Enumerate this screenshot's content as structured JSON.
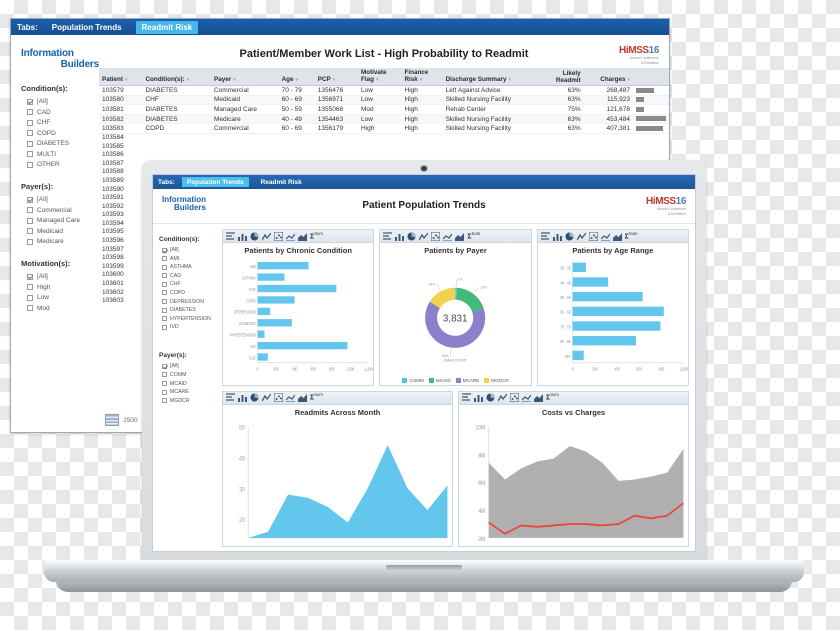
{
  "back_window": {
    "tabs_label": "Tabs:",
    "tabs": [
      {
        "label": "Population Trends",
        "active": false
      },
      {
        "label": "Readmit Risk",
        "active": true
      }
    ],
    "logo": {
      "line1": "Information",
      "line2": "Builders"
    },
    "title": "Patient/Member Work List - High Probability to Readmit",
    "himss": {
      "name": "HiMSS",
      "year": "16",
      "sub1": "Annual Conference",
      "sub2": "& Exhibition"
    },
    "filters": [
      {
        "label": "Condition(s):",
        "options": [
          {
            "text": "[All]",
            "checked": true
          },
          {
            "text": "CAD",
            "checked": false
          },
          {
            "text": "CHF",
            "checked": false
          },
          {
            "text": "COPD",
            "checked": false
          },
          {
            "text": "DIABETES",
            "checked": false
          },
          {
            "text": "MULTI",
            "checked": false
          },
          {
            "text": "OTHER",
            "checked": false
          }
        ]
      },
      {
        "label": "Payer(s):",
        "options": [
          {
            "text": "[All]",
            "checked": true
          },
          {
            "text": "Commercial",
            "checked": false
          },
          {
            "text": "Managed Care",
            "checked": false
          },
          {
            "text": "Medicaid",
            "checked": false
          },
          {
            "text": "Medicare",
            "checked": false
          }
        ]
      },
      {
        "label": "Motivation(s):",
        "options": [
          {
            "text": "[All]",
            "checked": true
          },
          {
            "text": "High",
            "checked": false
          },
          {
            "text": "Low",
            "checked": false
          },
          {
            "text": "Mod",
            "checked": false
          }
        ]
      }
    ],
    "table": {
      "columns": [
        "Patient",
        "Condition(s):",
        "Payer",
        "Age",
        "PCP",
        "Motivate\nFlag",
        "Finance\nRisk",
        "Discharge Summary",
        "Likely\nReadmit",
        "Charges",
        ""
      ],
      "rows": [
        {
          "patient": "103579",
          "condition": "DIABETES",
          "payer": "Commercial",
          "age": "70 - 79",
          "pcp": "1356476",
          "motivate": "Low",
          "finance": "High",
          "discharge": "Left Against Advice",
          "readmit": "63%",
          "charges": "268,487",
          "bar": 60
        },
        {
          "patient": "103580",
          "condition": "CHF",
          "payer": "Medicaid",
          "age": "60 - 69",
          "pcp": "1356971",
          "motivate": "Low",
          "finance": "High",
          "discharge": "Skilled Nursing Facility",
          "readmit": "63%",
          "charges": "115,923",
          "bar": 26
        },
        {
          "patient": "103581",
          "condition": "DIABETES",
          "payer": "Managed Care",
          "age": "50 - 59",
          "pcp": "1355068",
          "motivate": "Mod",
          "finance": "High",
          "discharge": "Rehab Center",
          "readmit": "75%",
          "charges": "121,678",
          "bar": 27
        },
        {
          "patient": "103582",
          "condition": "DIABETES",
          "payer": "Medicare",
          "age": "40 - 49",
          "pcp": "1354463",
          "motivate": "Low",
          "finance": "High",
          "discharge": "Skilled Nursing Facility",
          "readmit": "63%",
          "charges": "453,484",
          "bar": 100
        },
        {
          "patient": "103583",
          "condition": "COPD",
          "payer": "Commercial",
          "age": "60 - 69",
          "pcp": "1356179",
          "motivate": "High",
          "finance": "High",
          "discharge": "Skilled Nursing Facility",
          "readmit": "63%",
          "charges": "407,381",
          "bar": 90
        }
      ],
      "patient_ids_continued": [
        "103584",
        "103585",
        "103586",
        "103587",
        "103588",
        "103589",
        "103590",
        "103591",
        "103592",
        "103593",
        "103594",
        "103595",
        "103596",
        "103597",
        "103598",
        "103599",
        "103600",
        "103601",
        "103602",
        "103603"
      ],
      "footer_count": "2500"
    }
  },
  "laptop": {
    "tabs_label": "Tabs:",
    "tabs": [
      {
        "label": "Population Trends",
        "active": true
      },
      {
        "label": "Readmit Risk",
        "active": false
      }
    ],
    "logo": {
      "line1": "Information",
      "line2": "Builders"
    },
    "title": "Patient Population Trends",
    "himss": {
      "name": "HiMSS",
      "year": "16",
      "sub1": "Annual Conference",
      "sub2": "& Exhibition"
    },
    "toolbar": {
      "sum_label": "Σ",
      "sum_sup": "Sum"
    },
    "filters": [
      {
        "label": "Condition(s):",
        "options": [
          {
            "text": "[All]",
            "checked": true
          },
          {
            "text": "AMI",
            "checked": false
          },
          {
            "text": "ASTHMA",
            "checked": false
          },
          {
            "text": "CAD",
            "checked": false
          },
          {
            "text": "CHF",
            "checked": false
          },
          {
            "text": "COPD",
            "checked": false
          },
          {
            "text": "DEPRESSION",
            "checked": false
          },
          {
            "text": "DIABETES",
            "checked": false
          },
          {
            "text": "HYPERTENSION",
            "checked": false
          },
          {
            "text": "IVD",
            "checked": false
          }
        ]
      },
      {
        "label": "Payer(s):",
        "options": [
          {
            "text": "[All]",
            "checked": true
          },
          {
            "text": "COMM",
            "checked": false
          },
          {
            "text": "MCAID",
            "checked": false
          },
          {
            "text": "MCARE",
            "checked": false
          },
          {
            "text": "MGDCR",
            "checked": false
          }
        ]
      }
    ]
  },
  "chart_data": [
    {
      "type": "bar",
      "orientation": "horizontal",
      "title": "Patients by Chronic Condition",
      "categories": [
        "AMI",
        "ASTHMA",
        "CHF",
        "COPD",
        "DEPRESSION",
        "DIABETES",
        "HYPERTENSION",
        "IVD",
        "CAD"
      ],
      "values": [
        550,
        290,
        850,
        400,
        135,
        370,
        75,
        970,
        110
      ],
      "xlabel": "",
      "ylabel": "",
      "xlim": [
        0,
        1200
      ],
      "xticks": [
        "0",
        "200",
        "400",
        "600",
        "800",
        "1,000",
        "1,200"
      ],
      "color": "#63c6ec",
      "grid": false
    },
    {
      "type": "pie",
      "subtype": "donut",
      "title": "Patients by Payer",
      "center_value": "3,831",
      "center_caption": "Patient COUNT",
      "labels": [
        "COMM",
        "MCAID",
        "MCARE",
        "MGDCR"
      ],
      "values": [
        1,
        19,
        64,
        16
      ],
      "value_labels": [
        "1%",
        "19%",
        "64%",
        "16%"
      ],
      "colors": [
        "#4ec3e0",
        "#43b97a",
        "#8d7fc9",
        "#f2d24b"
      ],
      "legend": "bottom"
    },
    {
      "type": "bar",
      "orientation": "horizontal",
      "title": "Patients by Age Range",
      "categories": [
        "30 - 39",
        "40 - 49",
        "50 - 59",
        "60 - 69",
        "70 - 79",
        "80 - 89",
        "90+"
      ],
      "values": [
        120,
        320,
        630,
        820,
        790,
        570,
        100
      ],
      "xlim": [
        0,
        1000
      ],
      "xticks": [
        "0",
        "200",
        "400",
        "600",
        "800",
        "1,000"
      ],
      "color": "#63c6ec",
      "grid": false
    },
    {
      "type": "area",
      "title": "Readmits Across Month",
      "x": [
        1,
        2,
        3,
        4,
        5,
        6,
        7,
        8,
        9,
        10,
        11
      ],
      "values": [
        14,
        16,
        28,
        27,
        24,
        19,
        30,
        44,
        30,
        23,
        31
      ],
      "ylim": [
        14,
        50
      ],
      "yticks": [
        "20",
        "30",
        "40",
        "50"
      ],
      "color": "#63c6ec"
    },
    {
      "type": "area",
      "title": "Costs vs Charges",
      "series": [
        {
          "name": "Charges",
          "values": [
            7.4,
            6.2,
            7.0,
            7.5,
            7.7,
            8.6,
            8.2,
            7.4,
            6.1,
            6.2,
            6.4,
            6.7,
            8.4
          ],
          "color": "#b0b0b0",
          "style": "area"
        },
        {
          "name": "Costs",
          "values": [
            3.1,
            2.3,
            2.9,
            2.8,
            2.9,
            3.0,
            3.0,
            2.9,
            3.0,
            3.6,
            3.4,
            3.6,
            4.5
          ],
          "color": "#e8493a",
          "style": "line"
        }
      ],
      "ylim": [
        2,
        10
      ],
      "yticks": [
        "2M",
        "4M",
        "6M",
        "8M",
        "10M"
      ]
    }
  ]
}
